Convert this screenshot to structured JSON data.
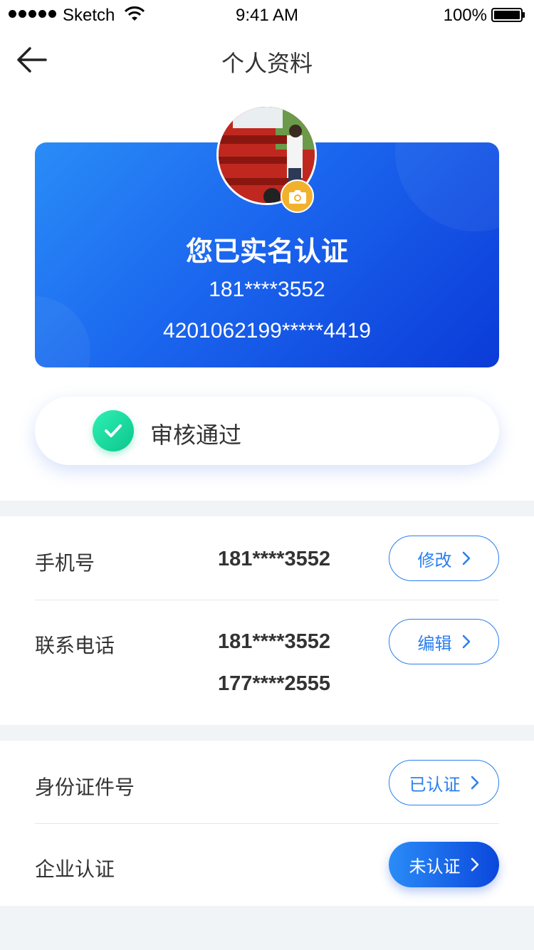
{
  "status_bar": {
    "carrier": "Sketch",
    "time": "9:41 AM",
    "battery": "100%"
  },
  "header": {
    "title": "个人资料"
  },
  "card": {
    "title": "您已实名认证",
    "phone": "181****3552",
    "id_number": "4201062199*****4419"
  },
  "approval": {
    "label": "审核通过"
  },
  "contact_section": {
    "mobile": {
      "label": "手机号",
      "value": "181****3552",
      "button": "修改"
    },
    "contact_phone": {
      "label": "联系电话",
      "values": [
        "181****3552",
        "177****2555"
      ],
      "button": "编辑"
    }
  },
  "verify_section": {
    "id_card": {
      "label": "身份证件号",
      "button": "已认证"
    },
    "enterprise": {
      "label": "企业认证",
      "button": "未认证"
    }
  },
  "colors": {
    "accent": "#2a7ff0",
    "card_start": "#2a8cf7",
    "card_end": "#0b3bd8",
    "success": "#14d69a",
    "camera_badge": "#f2b12d"
  }
}
